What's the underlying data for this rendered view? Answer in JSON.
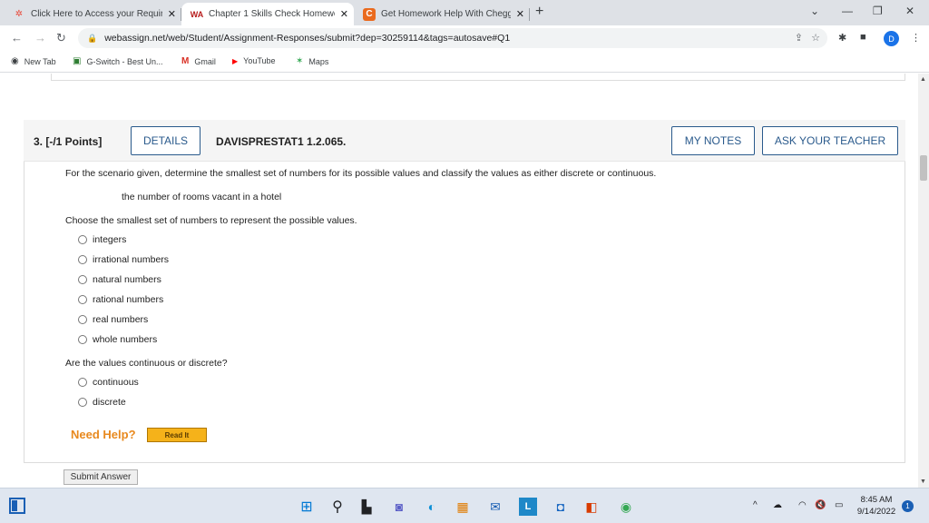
{
  "browser": {
    "tabs": [
      {
        "title": "Click Here to Access your Require",
        "close": "✕",
        "favicon": "✲",
        "favicon_color": "#e84b3c"
      },
      {
        "title": "Chapter 1 Skills Check Homewor",
        "close": "✕",
        "favicon": "WA",
        "favicon_color": "#b71c1c"
      },
      {
        "title": "Get Homework Help With Chegg",
        "close": "✕",
        "favicon": "C",
        "favicon_color": "#ea6a1d"
      }
    ],
    "new_tab": "+",
    "window_controls": {
      "chevron": "⌄",
      "minimize": "—",
      "restore": "❐",
      "close": "✕"
    },
    "url": "webassign.net/web/Student/Assignment-Responses/submit?dep=30259114&tags=autosave#Q1",
    "profile_initial": "D",
    "bookmarks": [
      {
        "label": "New Tab",
        "icon": "◉"
      },
      {
        "label": "G-Switch - Best Un...",
        "icon": "▣"
      },
      {
        "label": "Gmail",
        "icon": "M"
      },
      {
        "label": "YouTube",
        "icon": "▶"
      },
      {
        "label": "Maps",
        "icon": "✶"
      }
    ]
  },
  "question": {
    "number_label": "3. [-/1 Points]",
    "details_label": "DETAILS",
    "code": "DAVISPRESTAT1 1.2.065.",
    "my_notes_label": "MY NOTES",
    "ask_teacher_label": "ASK YOUR TEACHER",
    "prompt": "For the scenario given, determine the smallest set of numbers for its possible values and classify the values as either discrete or continuous.",
    "scenario": "the number of rooms vacant in a hotel",
    "part1_prompt": "Choose the smallest set of numbers to represent the possible values.",
    "part1_options": [
      "integers",
      "irrational numbers",
      "natural numbers",
      "rational numbers",
      "real numbers",
      "whole numbers"
    ],
    "part2_prompt": "Are the values continuous or discrete?",
    "part2_options": [
      "continuous",
      "discrete"
    ],
    "need_help": "Need Help?",
    "read_it": "Read It",
    "submit": "Submit Answer"
  },
  "taskbar": {
    "time": "8:45 AM",
    "date": "9/14/2022",
    "notifications": "1"
  }
}
